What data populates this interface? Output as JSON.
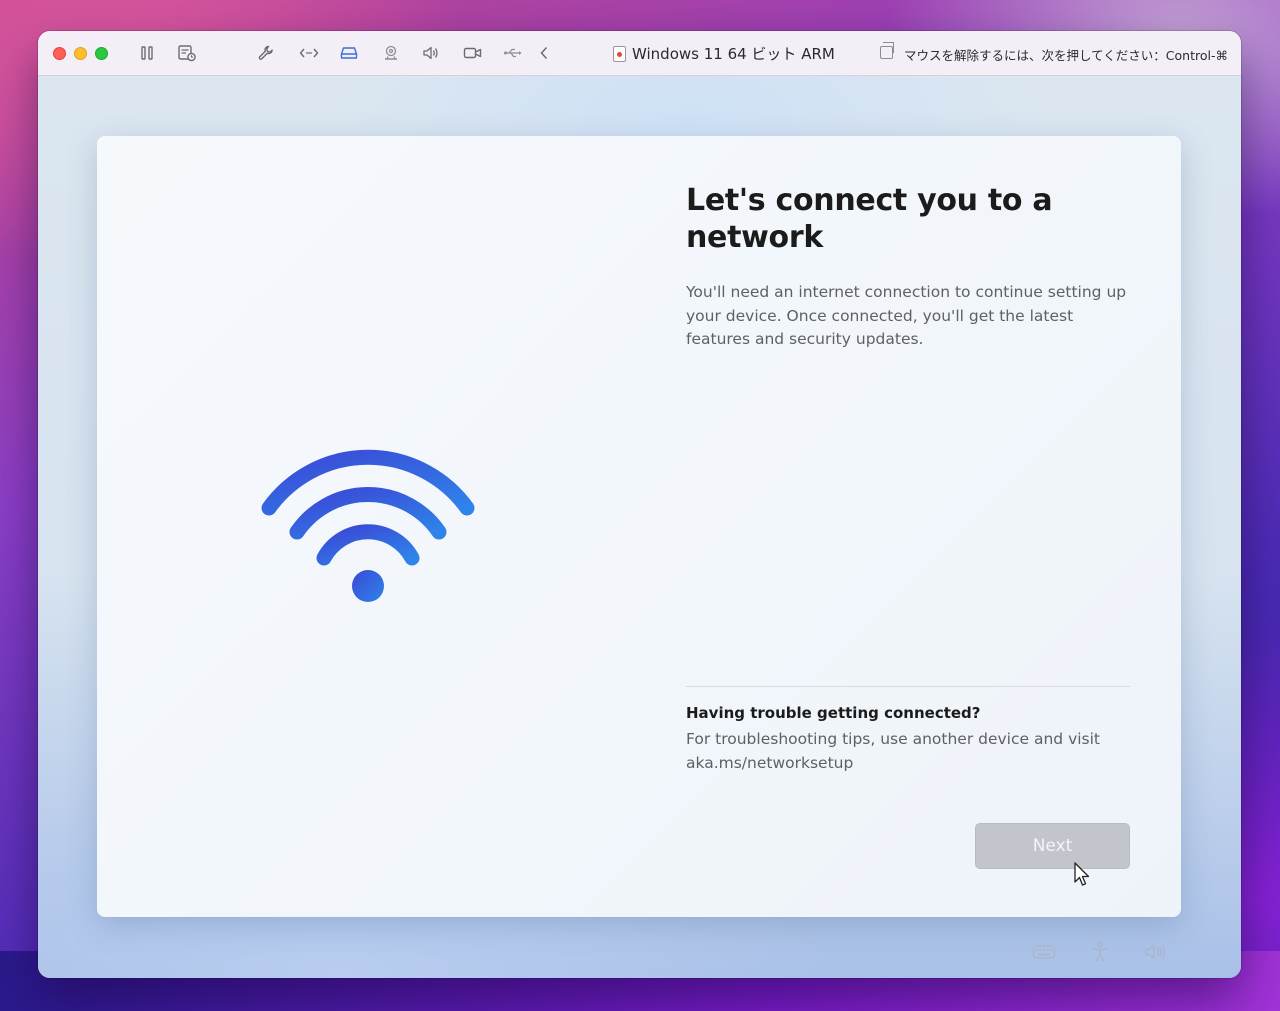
{
  "window": {
    "title": "Windows 11 64 ビット ARM",
    "release_hint": "マウスを解除するには、次を押してください：Control-⌘"
  },
  "toolbar": {
    "icons": [
      "pause-icon",
      "snapshot-icon",
      "wrench-icon",
      "code-arrows-icon",
      "hard-drive-icon",
      "webcam-icon",
      "speaker-icon",
      "video-camera-icon",
      "usb-icon",
      "chevron-left-icon",
      "capture-window-icon"
    ],
    "active_icon": "hard-drive-icon"
  },
  "oobe": {
    "heading": "Let's connect you to a network",
    "description": "You'll need an internet connection to continue setting up your device. Once connected, you'll get the latest features and security updates.",
    "trouble_title": "Having trouble getting connected?",
    "trouble_text": "For troubleshooting tips, use another device and visit aka.ms/networksetup",
    "next_label": "Next",
    "next_enabled": false
  },
  "tray": {
    "icons": [
      "keyboard-icon",
      "accessibility-icon",
      "volume-icon"
    ]
  },
  "colors": {
    "wifi_start": "#3a4fd8",
    "wifi_end": "#2f7ae8",
    "next_disabled_bg": "#c2c6cc"
  }
}
